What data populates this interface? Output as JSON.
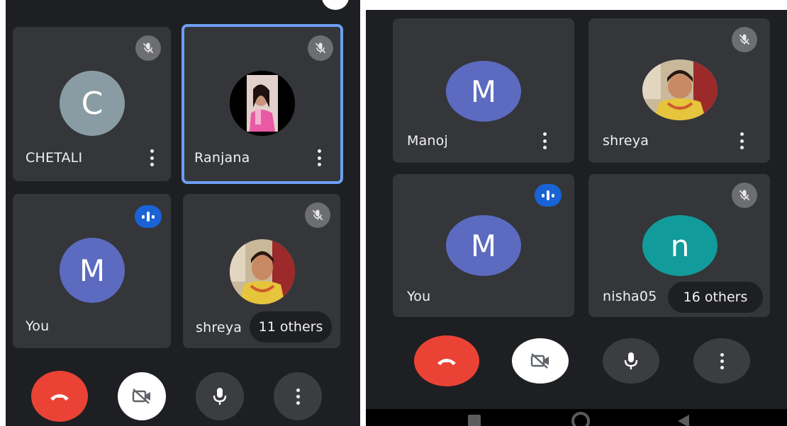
{
  "left": {
    "tiles": [
      {
        "name": "CHETALI",
        "initial": "C",
        "avatar_color": "#8a9ca3",
        "status": "muted"
      },
      {
        "name": "Ranjana",
        "initial": "",
        "avatar_color": "#000000",
        "status": "muted",
        "active": true
      },
      {
        "name": "You",
        "initial": "M",
        "avatar_color": "#5c6bc0",
        "status": "speaking"
      },
      {
        "name": "shreya",
        "initial": "",
        "status": "muted",
        "others": "11 others"
      }
    ]
  },
  "right": {
    "tiles": [
      {
        "name": "Manoj",
        "initial": "M",
        "avatar_color": "#5c6bc0"
      },
      {
        "name": "shreya",
        "initial": "",
        "status": "muted"
      },
      {
        "name": "You",
        "initial": "M",
        "avatar_color": "#5c6bc0",
        "status": "speaking"
      },
      {
        "name": "nisha05",
        "initial": "n",
        "avatar_color": "#129b9b",
        "status": "muted",
        "others": "16 others"
      }
    ]
  },
  "controls": {
    "end_call": "phone-hangup-icon",
    "camera": "camera-off-icon",
    "mic": "mic-icon",
    "more": "more-vert-icon"
  },
  "colors": {
    "background": "#1e1f22",
    "tile": "#34363a",
    "active_border": "#6b9ff2",
    "end_call": "#ea4335",
    "speaking": "#1a63d6",
    "muted_badge": "#6d6e71"
  }
}
